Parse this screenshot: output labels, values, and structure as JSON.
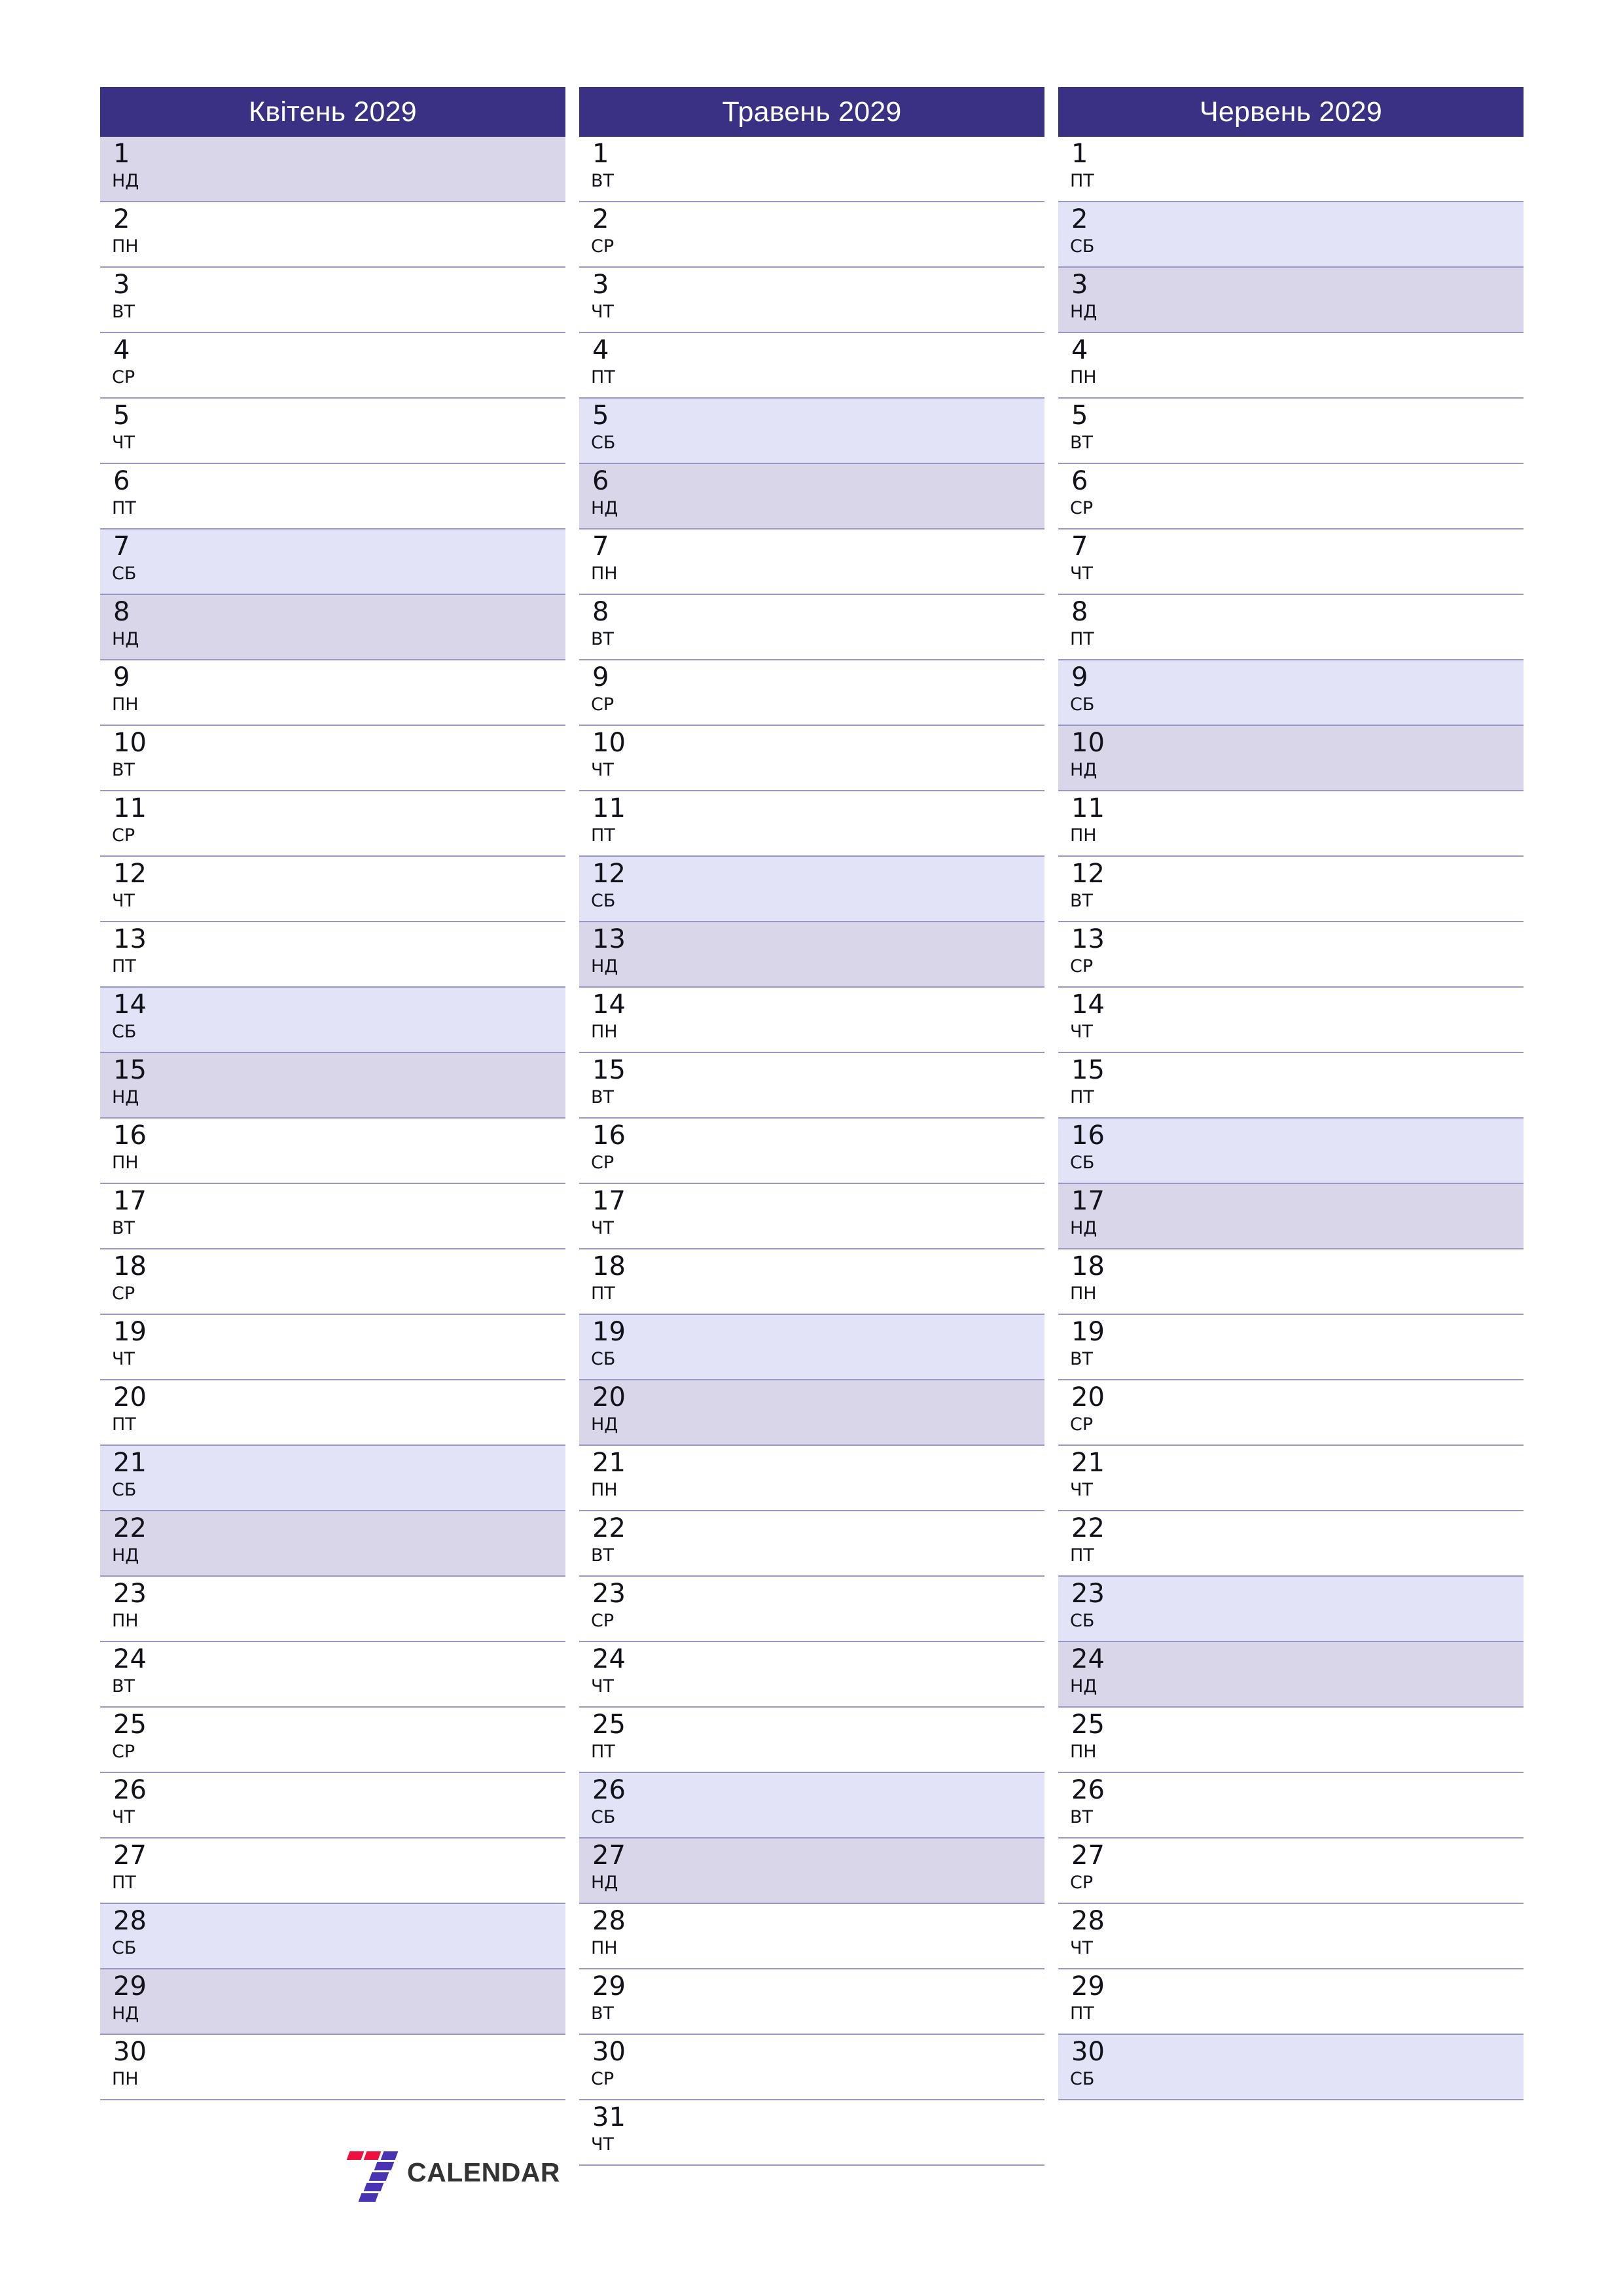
{
  "logo": {
    "mark_name": "seven-mark",
    "text": "CALENDAR",
    "accent_red": "#f01040",
    "accent_purple": "#4a32b4",
    "text_color": "#333333"
  },
  "theme": {
    "header_bg": "#3a3185",
    "header_text": "#ffffff",
    "saturday_bg": "#e3e3f7",
    "sunday_bg": "#dad6e9",
    "row_border": "#9a96c9",
    "day_text": "#12121a",
    "page_bg": "#ffffff"
  },
  "months": [
    {
      "title": "Квітень 2029",
      "name": "Квітень",
      "year": "2029",
      "days": [
        {
          "num": "1",
          "wd": "НД",
          "type": "sun"
        },
        {
          "num": "2",
          "wd": "ПН",
          "type": "weekday"
        },
        {
          "num": "3",
          "wd": "ВТ",
          "type": "weekday"
        },
        {
          "num": "4",
          "wd": "СР",
          "type": "weekday"
        },
        {
          "num": "5",
          "wd": "ЧТ",
          "type": "weekday"
        },
        {
          "num": "6",
          "wd": "ПТ",
          "type": "weekday"
        },
        {
          "num": "7",
          "wd": "СБ",
          "type": "sat"
        },
        {
          "num": "8",
          "wd": "НД",
          "type": "sun"
        },
        {
          "num": "9",
          "wd": "ПН",
          "type": "weekday"
        },
        {
          "num": "10",
          "wd": "ВТ",
          "type": "weekday"
        },
        {
          "num": "11",
          "wd": "СР",
          "type": "weekday"
        },
        {
          "num": "12",
          "wd": "ЧТ",
          "type": "weekday"
        },
        {
          "num": "13",
          "wd": "ПТ",
          "type": "weekday"
        },
        {
          "num": "14",
          "wd": "СБ",
          "type": "sat"
        },
        {
          "num": "15",
          "wd": "НД",
          "type": "sun"
        },
        {
          "num": "16",
          "wd": "ПН",
          "type": "weekday"
        },
        {
          "num": "17",
          "wd": "ВТ",
          "type": "weekday"
        },
        {
          "num": "18",
          "wd": "СР",
          "type": "weekday"
        },
        {
          "num": "19",
          "wd": "ЧТ",
          "type": "weekday"
        },
        {
          "num": "20",
          "wd": "ПТ",
          "type": "weekday"
        },
        {
          "num": "21",
          "wd": "СБ",
          "type": "sat"
        },
        {
          "num": "22",
          "wd": "НД",
          "type": "sun"
        },
        {
          "num": "23",
          "wd": "ПН",
          "type": "weekday"
        },
        {
          "num": "24",
          "wd": "ВТ",
          "type": "weekday"
        },
        {
          "num": "25",
          "wd": "СР",
          "type": "weekday"
        },
        {
          "num": "26",
          "wd": "ЧТ",
          "type": "weekday"
        },
        {
          "num": "27",
          "wd": "ПТ",
          "type": "weekday"
        },
        {
          "num": "28",
          "wd": "СБ",
          "type": "sat"
        },
        {
          "num": "29",
          "wd": "НД",
          "type": "sun"
        },
        {
          "num": "30",
          "wd": "ПН",
          "type": "weekday"
        }
      ]
    },
    {
      "title": "Травень 2029",
      "name": "Травень",
      "year": "2029",
      "days": [
        {
          "num": "1",
          "wd": "ВТ",
          "type": "weekday"
        },
        {
          "num": "2",
          "wd": "СР",
          "type": "weekday"
        },
        {
          "num": "3",
          "wd": "ЧТ",
          "type": "weekday"
        },
        {
          "num": "4",
          "wd": "ПТ",
          "type": "weekday"
        },
        {
          "num": "5",
          "wd": "СБ",
          "type": "sat"
        },
        {
          "num": "6",
          "wd": "НД",
          "type": "sun"
        },
        {
          "num": "7",
          "wd": "ПН",
          "type": "weekday"
        },
        {
          "num": "8",
          "wd": "ВТ",
          "type": "weekday"
        },
        {
          "num": "9",
          "wd": "СР",
          "type": "weekday"
        },
        {
          "num": "10",
          "wd": "ЧТ",
          "type": "weekday"
        },
        {
          "num": "11",
          "wd": "ПТ",
          "type": "weekday"
        },
        {
          "num": "12",
          "wd": "СБ",
          "type": "sat"
        },
        {
          "num": "13",
          "wd": "НД",
          "type": "sun"
        },
        {
          "num": "14",
          "wd": "ПН",
          "type": "weekday"
        },
        {
          "num": "15",
          "wd": "ВТ",
          "type": "weekday"
        },
        {
          "num": "16",
          "wd": "СР",
          "type": "weekday"
        },
        {
          "num": "17",
          "wd": "ЧТ",
          "type": "weekday"
        },
        {
          "num": "18",
          "wd": "ПТ",
          "type": "weekday"
        },
        {
          "num": "19",
          "wd": "СБ",
          "type": "sat"
        },
        {
          "num": "20",
          "wd": "НД",
          "type": "sun"
        },
        {
          "num": "21",
          "wd": "ПН",
          "type": "weekday"
        },
        {
          "num": "22",
          "wd": "ВТ",
          "type": "weekday"
        },
        {
          "num": "23",
          "wd": "СР",
          "type": "weekday"
        },
        {
          "num": "24",
          "wd": "ЧТ",
          "type": "weekday"
        },
        {
          "num": "25",
          "wd": "ПТ",
          "type": "weekday"
        },
        {
          "num": "26",
          "wd": "СБ",
          "type": "sat"
        },
        {
          "num": "27",
          "wd": "НД",
          "type": "sun"
        },
        {
          "num": "28",
          "wd": "ПН",
          "type": "weekday"
        },
        {
          "num": "29",
          "wd": "ВТ",
          "type": "weekday"
        },
        {
          "num": "30",
          "wd": "СР",
          "type": "weekday"
        },
        {
          "num": "31",
          "wd": "ЧТ",
          "type": "weekday"
        }
      ]
    },
    {
      "title": "Червень 2029",
      "name": "Червень",
      "year": "2029",
      "days": [
        {
          "num": "1",
          "wd": "ПТ",
          "type": "weekday"
        },
        {
          "num": "2",
          "wd": "СБ",
          "type": "sat"
        },
        {
          "num": "3",
          "wd": "НД",
          "type": "sun"
        },
        {
          "num": "4",
          "wd": "ПН",
          "type": "weekday"
        },
        {
          "num": "5",
          "wd": "ВТ",
          "type": "weekday"
        },
        {
          "num": "6",
          "wd": "СР",
          "type": "weekday"
        },
        {
          "num": "7",
          "wd": "ЧТ",
          "type": "weekday"
        },
        {
          "num": "8",
          "wd": "ПТ",
          "type": "weekday"
        },
        {
          "num": "9",
          "wd": "СБ",
          "type": "sat"
        },
        {
          "num": "10",
          "wd": "НД",
          "type": "sun"
        },
        {
          "num": "11",
          "wd": "ПН",
          "type": "weekday"
        },
        {
          "num": "12",
          "wd": "ВТ",
          "type": "weekday"
        },
        {
          "num": "13",
          "wd": "СР",
          "type": "weekday"
        },
        {
          "num": "14",
          "wd": "ЧТ",
          "type": "weekday"
        },
        {
          "num": "15",
          "wd": "ПТ",
          "type": "weekday"
        },
        {
          "num": "16",
          "wd": "СБ",
          "type": "sat"
        },
        {
          "num": "17",
          "wd": "НД",
          "type": "sun"
        },
        {
          "num": "18",
          "wd": "ПН",
          "type": "weekday"
        },
        {
          "num": "19",
          "wd": "ВТ",
          "type": "weekday"
        },
        {
          "num": "20",
          "wd": "СР",
          "type": "weekday"
        },
        {
          "num": "21",
          "wd": "ЧТ",
          "type": "weekday"
        },
        {
          "num": "22",
          "wd": "ПТ",
          "type": "weekday"
        },
        {
          "num": "23",
          "wd": "СБ",
          "type": "sat"
        },
        {
          "num": "24",
          "wd": "НД",
          "type": "sun"
        },
        {
          "num": "25",
          "wd": "ПН",
          "type": "weekday"
        },
        {
          "num": "26",
          "wd": "ВТ",
          "type": "weekday"
        },
        {
          "num": "27",
          "wd": "СР",
          "type": "weekday"
        },
        {
          "num": "28",
          "wd": "ЧТ",
          "type": "weekday"
        },
        {
          "num": "29",
          "wd": "ПТ",
          "type": "weekday"
        },
        {
          "num": "30",
          "wd": "СБ",
          "type": "sat"
        }
      ]
    }
  ]
}
